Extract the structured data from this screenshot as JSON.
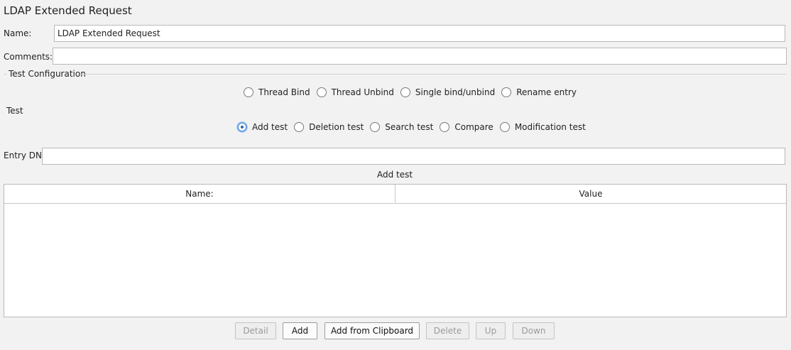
{
  "header": {
    "title": "LDAP Extended Request"
  },
  "form": {
    "name_label": "Name:",
    "name_value": "LDAP Extended Request",
    "comments_label": "Comments:",
    "comments_value": ""
  },
  "test_configuration": {
    "group_title": "Test Configuration",
    "bind_options": [
      "Thread Bind",
      "Thread Unbind",
      "Single bind/unbind",
      "Rename entry"
    ],
    "test_label": "Test",
    "test_options": [
      "Add test",
      "Deletion test",
      "Search test",
      "Compare",
      "Modification test"
    ],
    "selected_test": "Add test"
  },
  "entry": {
    "label": "Entry DN",
    "value": ""
  },
  "table": {
    "section_title": "Add test",
    "columns": [
      "Name:",
      "Value"
    ],
    "rows": []
  },
  "buttons": {
    "detail": "Detail",
    "add": "Add",
    "add_from_clipboard": "Add from Clipboard",
    "delete": "Delete",
    "up": "Up",
    "down": "Down"
  }
}
